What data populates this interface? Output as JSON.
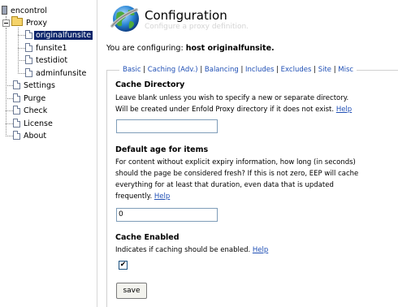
{
  "tree": {
    "root": "encontrol",
    "proxy": "Proxy",
    "sites": [
      "originalfunsite",
      "funsite1",
      "testidiot",
      "adminfunsite"
    ],
    "items": [
      "Settings",
      "Purge",
      "Check",
      "License",
      "About"
    ]
  },
  "header": {
    "title": "Configuration",
    "subtitle": "Configure a proxy definition."
  },
  "configuring": {
    "prefix": "You are configuring:",
    "target": "host originalfunsite."
  },
  "tabs": [
    "Basic",
    "Caching",
    "(Adv.)",
    "Balancing",
    "Includes",
    "Excludes",
    "Site",
    "Misc"
  ],
  "sections": {
    "cache_directory": {
      "title": "Cache Directory",
      "desc_line1": "Leave blank unless you wish to specify a new or separate directory.",
      "desc_line2": "Will be created under Enfold Proxy directory if it does not exist.",
      "help": "Help",
      "value": ""
    },
    "default_age": {
      "title": "Default age for items",
      "desc_line1": "For content without explicit expiry information, how long (in seconds)",
      "desc_line2": "should the page be considered fresh? If this is not zero, EEP will cache",
      "desc_line3": "everything for at least that duration, even data that is updated",
      "desc_line4": "frequently.",
      "help": "Help",
      "value": "0"
    },
    "cache_enabled": {
      "title": "Cache Enabled",
      "desc": "Indicates if caching should be enabled.",
      "help": "Help",
      "checked_mark": "✔"
    }
  },
  "save_label": "save",
  "colors": {
    "link": "#1f4fb5",
    "selection": "#0a246a"
  }
}
